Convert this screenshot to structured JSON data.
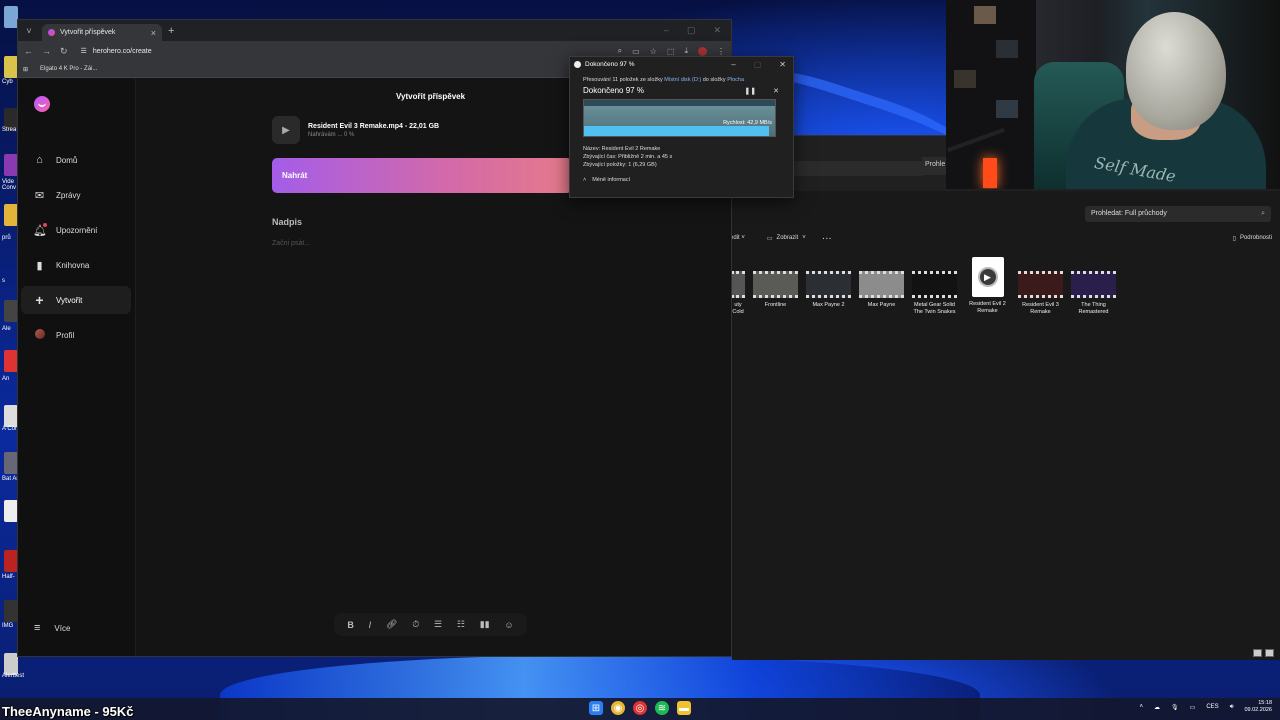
{
  "browser": {
    "tab_title": "Vytvořit příspěvek",
    "url": "herohero.co/create",
    "bookmark": "Elgato 4 K Pro - Zái..."
  },
  "sidebar": {
    "items": [
      {
        "label": "Domů",
        "icon": "home-icon"
      },
      {
        "label": "Zprávy",
        "icon": "messages-icon"
      },
      {
        "label": "Upozornění",
        "icon": "bell-icon"
      },
      {
        "label": "Knihovna",
        "icon": "bookmark-icon"
      },
      {
        "label": "Vytvořit",
        "icon": "plus-icon"
      },
      {
        "label": "Profil",
        "icon": "avatar-icon"
      }
    ],
    "more_label": "Více"
  },
  "create": {
    "title": "Vytvořit příspěvek",
    "file_name": "Resident Evil 3 Remake.mp4 - 22,01 GB",
    "upload_status": "Nahrávám ... 0 %",
    "upload_button": "Nahrát",
    "heading_placeholder": "Nadpis",
    "body_placeholder": "Začni psát..."
  },
  "editor_toolbar": [
    "B",
    "I",
    "link",
    "timer",
    "list-numbered",
    "list-bulleted",
    "chart",
    "emoji"
  ],
  "copy_dialog": {
    "window_title": "Dokončeno 97 %",
    "desc_prefix": "Přesouvání 11 položek ze složky ",
    "desc_source": "Místní disk (D:)",
    "desc_mid": " do složky ",
    "desc_target": "Plocha",
    "progress_label": "Dokončeno 97 %",
    "progress": 0.97,
    "speed": "Rychlost: 42,9 MB/s",
    "name_line": "Název: Resident Evil 2 Remake",
    "time_line": "Zbývající čas: Přibližně 2 min. a 45 s",
    "items_line": "Zbývající položky: 1 (6,29 GB)",
    "less_info": "Méně informací"
  },
  "explorer": {
    "search_top": "Prohle",
    "search": "Prohledat: Full průchody",
    "sort_label": "edit",
    "view_label": "Zobrazit",
    "details_label": "Podrobnosti",
    "files": [
      {
        "name": "uty\nCold"
      },
      {
        "name": "Frontline"
      },
      {
        "name": "Max Payne 2"
      },
      {
        "name": "Max Payne"
      },
      {
        "name": "Metal Gear Solid\nThe Twin Snakes"
      },
      {
        "name": "Resident Evil 2\nRemake"
      },
      {
        "name": "Resident Evil 3\nRemake"
      },
      {
        "name": "The Thing\nRemastered"
      }
    ]
  },
  "desktop": {
    "labels": [
      "Cyb",
      "Strea",
      "Vide Conv",
      "prů",
      "s",
      "Ale",
      "An",
      "A Cor",
      "Bat Ar",
      "Half-",
      "IMG",
      "Alerttest"
    ]
  },
  "overlay": {
    "donation": "TheeAnyname - 95Kč"
  },
  "taskbar": {
    "lang": "CES",
    "time": "15:18",
    "date": "09.02.2026"
  },
  "webcam": {
    "shirt_text": "Self Made"
  }
}
